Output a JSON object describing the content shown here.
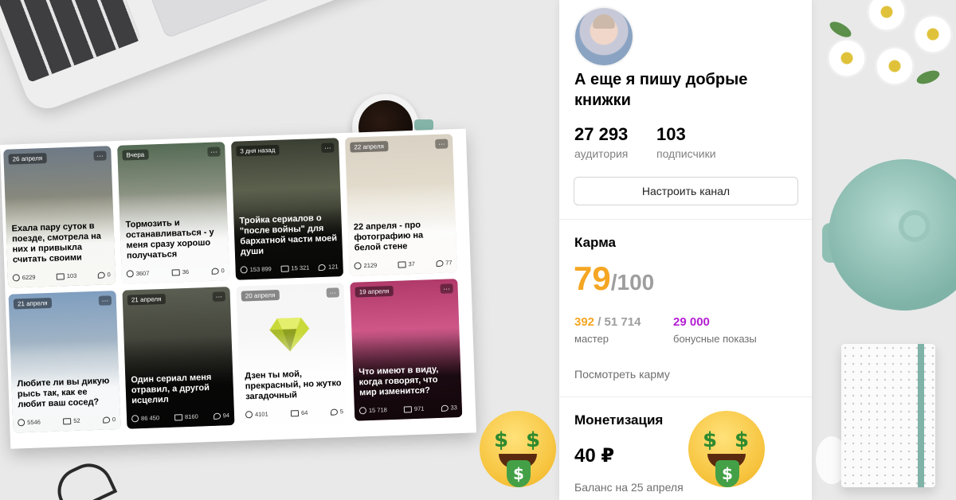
{
  "feed": {
    "cards": [
      {
        "badge": "26 апреля",
        "title": "Ехала пару суток в поезде, смотрела на них и привыкла считать своими",
        "views": "6229",
        "reads": "103",
        "comments": "0"
      },
      {
        "badge": "Вчера",
        "title": "Тормозить и останавливаться - у меня сразу хорошо получаться",
        "views": "3607",
        "reads": "36",
        "comments": "0"
      },
      {
        "badge": "3 дня назад",
        "title": "Тройка сериалов о \"после войны\" для бархатной части моей души",
        "views": "153 899",
        "reads": "15 321",
        "comments": "121"
      },
      {
        "badge": "22 апреля",
        "title": "22 апреля - про фотографию на белой стене",
        "views": "2129",
        "reads": "37",
        "comments": "77"
      },
      {
        "badge": "21 апреля",
        "title": "Любите ли вы дикую рысь так, как ее любит ваш сосед?",
        "views": "5546",
        "reads": "52",
        "comments": "0"
      },
      {
        "badge": "21 апреля",
        "title": "Один сериал меня отравил, а другой исцелил",
        "views": "86 450",
        "reads": "8160",
        "comments": "94"
      },
      {
        "badge": "20 апреля",
        "title": "Дзен ты мой, прекрасный, но жутко загадочный",
        "views": "4101",
        "reads": "64",
        "comments": "5"
      },
      {
        "badge": "19 апреля",
        "title": "Что имеют в виду, когда говорят, что мир изменится?",
        "views": "15 718",
        "reads": "971",
        "comments": "33"
      }
    ]
  },
  "channel": {
    "name": "А еще я пишу добрые книжки",
    "audience_value": "27 293",
    "audience_label": "аудитория",
    "subscribers_value": "103",
    "subscribers_label": "подписчики",
    "configure_button": "Настроить канал"
  },
  "karma": {
    "heading": "Карма",
    "score": "79",
    "max": "/100",
    "master_value": "392",
    "master_total": "/ 51 714",
    "master_label": "мастер",
    "bonus_value": "29 000",
    "bonus_label": "бонусные показы",
    "link": "Посмотреть карму",
    "accent_color": "#f5a623",
    "bonus_color": "#b41fd3"
  },
  "monetization": {
    "heading": "Монетизация",
    "amount": "40 ₽",
    "balance_label": "Баланс на 25 апреля"
  }
}
